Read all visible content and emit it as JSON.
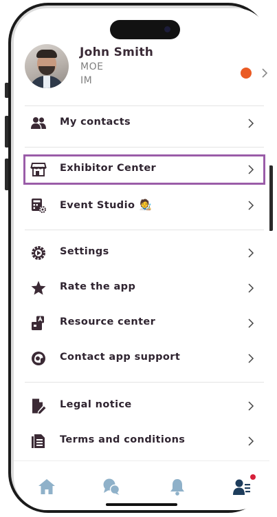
{
  "profile": {
    "name": "John Smith",
    "line1": "MOE",
    "line2": "IM",
    "status_color": "#ea5b24"
  },
  "menu": {
    "my_contacts": "My contacts",
    "exhibitor_center": "Exhibitor Center",
    "event_studio": "Event Studio",
    "event_studio_emoji": "🧑‍🎨",
    "settings": "Settings",
    "rate_app": "Rate the app",
    "resource_center": "Resource center",
    "contact_support": "Contact app support",
    "legal_notice": "Legal notice",
    "terms": "Terms and conditions"
  },
  "icons": {
    "contacts": "people-icon",
    "exhibitor": "storefront-icon",
    "event_studio": "calculator-gear-icon",
    "settings": "gear-icon",
    "rate": "star-icon",
    "resource": "resource-icon",
    "support": "headset-icon",
    "legal": "document-pen-icon",
    "terms": "documents-icon",
    "chevron": "chevron-right-icon"
  },
  "tabbar": {
    "active_color": "#1e3d5c",
    "inactive_color": "#8fb1c9",
    "badge_color": "#d6203a",
    "tabs": [
      "home-icon",
      "chat-icon",
      "bell-icon",
      "profile-menu-icon"
    ]
  },
  "highlight_color": "#9a5ca8"
}
